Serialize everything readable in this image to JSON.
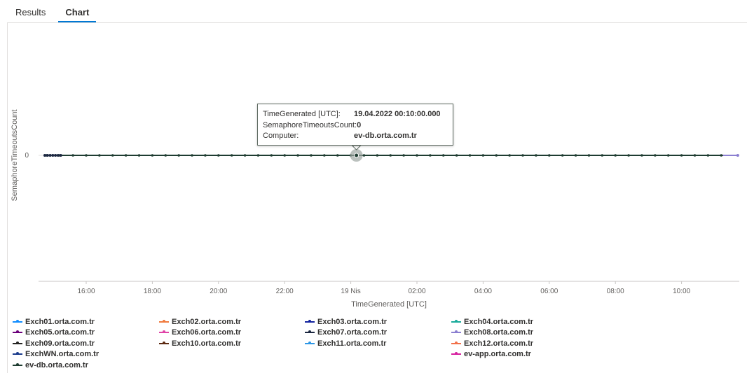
{
  "tabs": [
    {
      "label": "Results",
      "active": false
    },
    {
      "label": "Chart",
      "active": true
    }
  ],
  "tooltip": {
    "rows": [
      {
        "key": "TimeGenerated [UTC]:",
        "value": "19.04.2022 00:10:00.000"
      },
      {
        "key": "SemaphoreTimeoutsCount:",
        "value": "0"
      },
      {
        "key": "Computer:",
        "value": "ev-db.orta.com.tr"
      }
    ]
  },
  "chart_data": {
    "type": "line",
    "xlabel": "TimeGenerated [UTC]",
    "ylabel": "SemaphoreTimeoutsCount",
    "x_ticks": [
      "16:00",
      "18:00",
      "20:00",
      "22:00",
      "19 Nis",
      "02:00",
      "04:00",
      "06:00",
      "08:00",
      "10:00"
    ],
    "x_tick_hours": [
      16,
      18,
      20,
      22,
      24,
      26,
      28,
      30,
      32,
      34
    ],
    "x_range_hours": [
      14.75,
      35.7
    ],
    "y_ticks": [
      "0"
    ],
    "y_value": 0,
    "highlight": {
      "x_hour": 24.17,
      "y": 0,
      "series": "ev-db.orta.com.tr"
    },
    "series": [
      {
        "name": "Exch01.orta.com.tr",
        "color": "#118dff"
      },
      {
        "name": "Exch02.orta.com.tr",
        "color": "#f07b3f"
      },
      {
        "name": "Exch03.orta.com.tr",
        "color": "#12239e"
      },
      {
        "name": "Exch04.orta.com.tr",
        "color": "#1aab9b"
      },
      {
        "name": "Exch05.orta.com.tr",
        "color": "#6b007b"
      },
      {
        "name": "Exch06.orta.com.tr",
        "color": "#e044a7"
      },
      {
        "name": "Exch07.orta.com.tr",
        "color": "#1c2841"
      },
      {
        "name": "Exch08.orta.com.tr",
        "color": "#8b7fd1"
      },
      {
        "name": "Exch09.orta.com.tr",
        "color": "#252423"
      },
      {
        "name": "Exch10.orta.com.tr",
        "color": "#5c2a11"
      },
      {
        "name": "Exch11.orta.com.tr",
        "color": "#2e97e6"
      },
      {
        "name": "Exch12.orta.com.tr",
        "color": "#f2714a"
      },
      {
        "name": "ExchWN.orta.com.tr",
        "color": "#1a3b8c"
      },
      {
        "name": "ev-app.orta.com.tr",
        "color": "#d6209f"
      },
      {
        "name": "ev-db.orta.com.tr",
        "color": "#1e3c31"
      }
    ]
  }
}
